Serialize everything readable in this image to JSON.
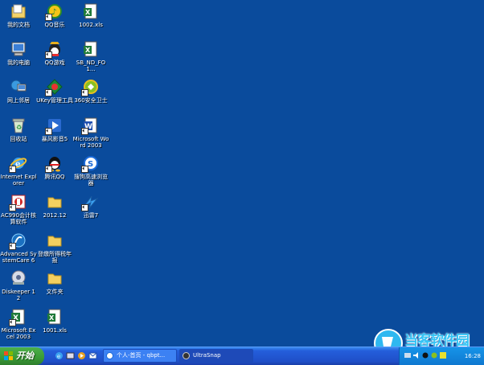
{
  "desktop": {
    "icons": [
      {
        "label": "我的文档",
        "icon": "my-documents-icon"
      },
      {
        "label": "QQ音乐",
        "icon": "qq-music-icon"
      },
      {
        "label": "1002.xls",
        "icon": "excel-file-icon"
      },
      {
        "label": "我的电脑",
        "icon": "my-computer-icon"
      },
      {
        "label": "QQ游戏",
        "icon": "qq-game-icon"
      },
      {
        "label": "SB_ND_FO1...",
        "icon": "document-file-icon"
      },
      {
        "label": "网上邻居",
        "icon": "network-places-icon"
      },
      {
        "label": "UKey管理工具",
        "icon": "ukey-tool-icon"
      },
      {
        "label": "360安全卫士",
        "icon": "security-360-icon"
      },
      {
        "label": "回收站",
        "icon": "recycle-bin-icon"
      },
      {
        "label": "暴风影音5",
        "icon": "baofeng-player-icon"
      },
      {
        "label": "Microsoft Word 2003",
        "icon": "word-icon"
      },
      {
        "label": "Internet Explorer",
        "icon": "ie-icon"
      },
      {
        "label": "腾讯QQ",
        "icon": "qq-penguin-icon"
      },
      {
        "label": "搜狗高速浏览器",
        "icon": "sogou-browser-icon"
      },
      {
        "label": "AC990会计核算软件",
        "icon": "accounting-software-icon"
      },
      {
        "label": "2012.12",
        "icon": "folder-icon"
      },
      {
        "label": "迅雷7",
        "icon": "xunlei-icon"
      },
      {
        "label": "Advanced SystemCare 6",
        "icon": "systemcare-icon"
      },
      {
        "label": "登缴所得税年报",
        "icon": "folder-icon"
      },
      {
        "label": "Diskeeper 12",
        "icon": "diskeeper-icon"
      },
      {
        "label": "文件夹",
        "icon": "folder-icon"
      },
      {
        "label": "Microsoft Excel 2003",
        "icon": "excel-icon"
      },
      {
        "label": "1001.xls",
        "icon": "excel-file-icon"
      }
    ]
  },
  "taskbar": {
    "start_label": "开始",
    "quick_launch": [
      "ie-quick-icon",
      "show-desktop-icon",
      "media-icon",
      "outlook-icon"
    ],
    "tasks": [
      {
        "label": "个人-首页 - qbpt...",
        "icon": "sogou-browser-icon",
        "active": false
      },
      {
        "label": "UltraSnap",
        "icon": "ultrasnap-icon",
        "active": true
      }
    ],
    "clock": "16:28"
  },
  "watermark": {
    "text": "当客软件园"
  },
  "colors": {
    "desktop": "#0a4b9c",
    "taskbar": "#245edb",
    "start": "#3a9a36",
    "tray": "#1694e8"
  }
}
